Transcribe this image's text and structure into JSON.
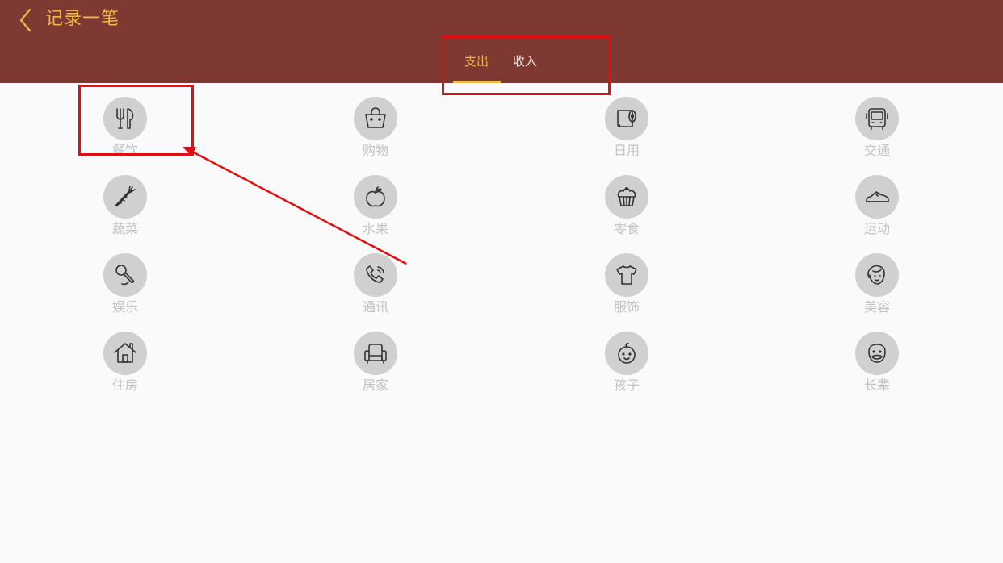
{
  "header": {
    "back_icon": "chevron-left-icon",
    "title": "记录一笔",
    "colors": {
      "background": "#7e3a32",
      "accent": "#f2b84b"
    }
  },
  "tabs": [
    {
      "label": "支出",
      "active": true
    },
    {
      "label": "收入",
      "active": false
    }
  ],
  "categories": [
    {
      "label": "餐饮",
      "icon": "utensils-icon"
    },
    {
      "label": "购物",
      "icon": "shopping-basket-icon"
    },
    {
      "label": "日用",
      "icon": "tissue-roll-icon"
    },
    {
      "label": "交通",
      "icon": "bus-icon"
    },
    {
      "label": "蔬菜",
      "icon": "carrot-icon"
    },
    {
      "label": "水果",
      "icon": "apple-icon"
    },
    {
      "label": "零食",
      "icon": "cupcake-icon"
    },
    {
      "label": "运动",
      "icon": "sneaker-icon"
    },
    {
      "label": "娱乐",
      "icon": "microphone-icon"
    },
    {
      "label": "通讯",
      "icon": "phone-icon"
    },
    {
      "label": "服饰",
      "icon": "tshirt-icon"
    },
    {
      "label": "美容",
      "icon": "face-icon"
    },
    {
      "label": "住房",
      "icon": "house-icon"
    },
    {
      "label": "居家",
      "icon": "armchair-icon"
    },
    {
      "label": "孩子",
      "icon": "baby-icon"
    },
    {
      "label": "长辈",
      "icon": "elder-icon"
    }
  ],
  "annotation_color": "#e01010"
}
